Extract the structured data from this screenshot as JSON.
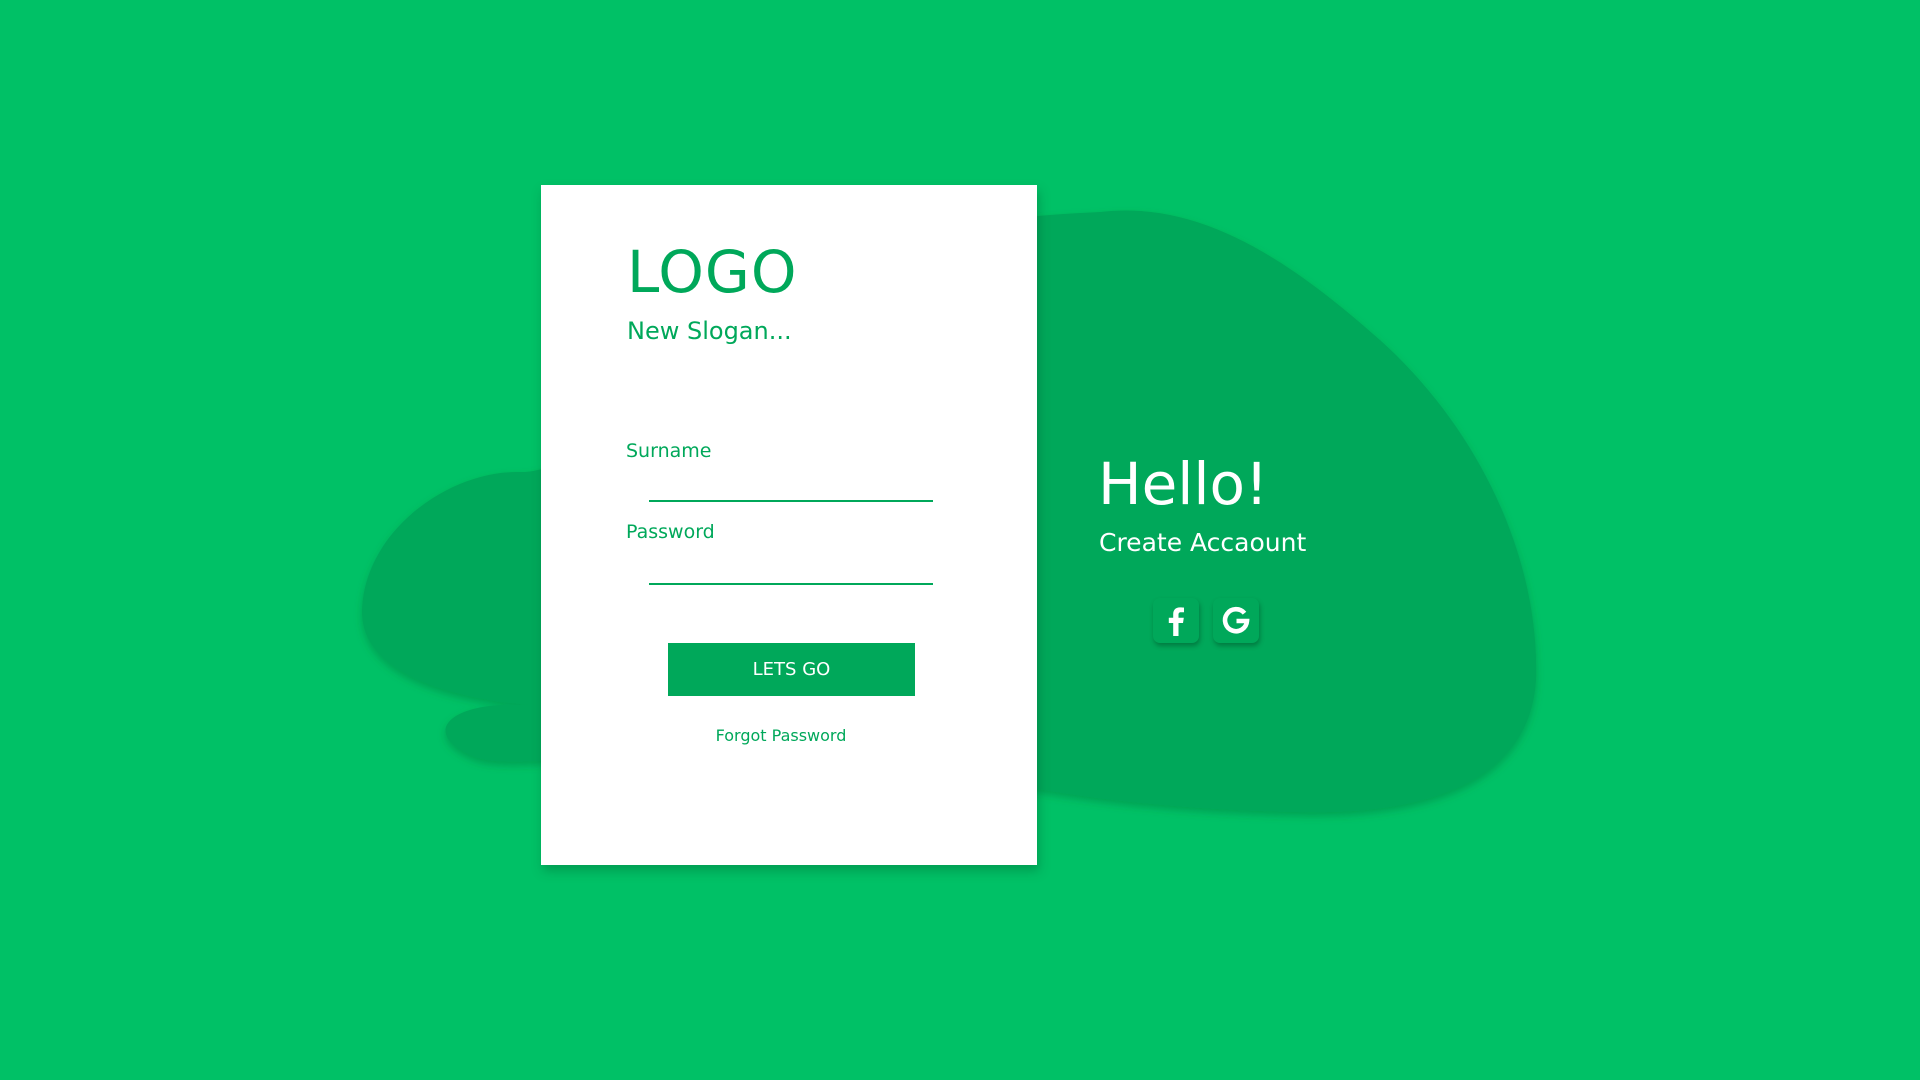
{
  "theme": {
    "background": "#00C166",
    "blob_color": "#00A85A",
    "card_background": "#FFFFFF",
    "accent": "#00A85A",
    "text_on_green": "#FFFFFF"
  },
  "login_card": {
    "logo": "LOGO",
    "slogan": "New Slogan...",
    "fields": [
      {
        "label": "Surname",
        "value": "",
        "placeholder": ""
      },
      {
        "label": "Password",
        "value": "",
        "placeholder": ""
      }
    ],
    "submit_label": "LETS GO",
    "forgot_label": "Forgot Password"
  },
  "welcome": {
    "greeting": "Hello!",
    "create_account_label": "Create Accaount",
    "social": [
      {
        "name": "facebook",
        "icon": "facebook-icon"
      },
      {
        "name": "google",
        "icon": "google-icon"
      }
    ]
  }
}
